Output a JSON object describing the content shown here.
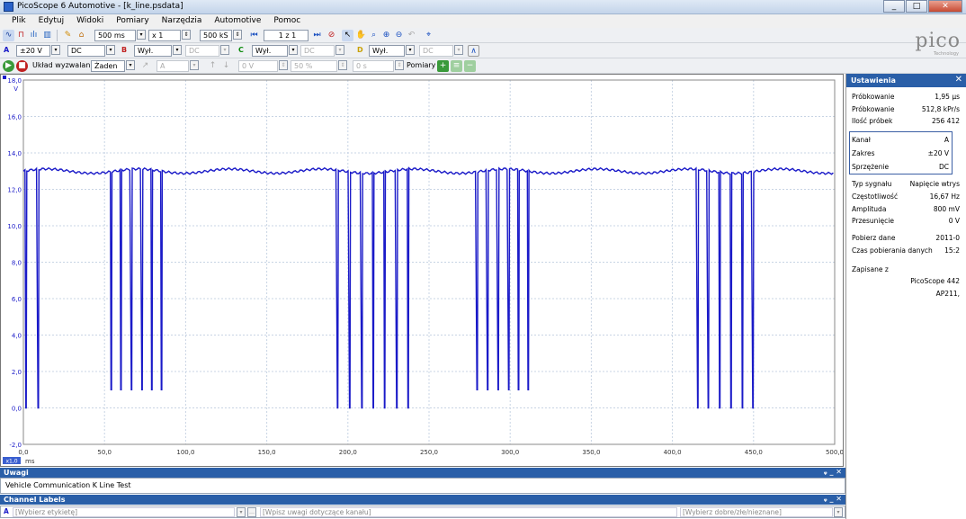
{
  "window": {
    "title": "PicoScope 6 Automotive - [k_line.psdata]",
    "min": "_",
    "max": "□",
    "close": "✕"
  },
  "menu": [
    "Plik",
    "Edytuj",
    "Widoki",
    "Pomiary",
    "Narzędzia",
    "Automotive",
    "Pomoc"
  ],
  "toolbar1": {
    "timebase": "500 ms",
    "zoom": "x 1",
    "samples": "500 kS",
    "buffer": "1 z 1"
  },
  "toolbar2": {
    "ch_a_label": "A",
    "ch_a_range": "±20 V",
    "ch_a_coupling": "DC",
    "ch_b_label": "B",
    "ch_b_range": "Wył.",
    "ch_b_coupling": "DC",
    "ch_c_label": "C",
    "ch_c_range": "Wył.",
    "ch_c_coupling": "DC",
    "ch_d_label": "D",
    "ch_d_range": "Wył.",
    "ch_d_coupling": "DC"
  },
  "toolbar3": {
    "trigger_label": "Układ wyzwalania",
    "trigger_mode": "Żaden",
    "trigger_channel": "A",
    "trigger_level": "0 V",
    "trigger_pre": "50 %",
    "trigger_delay": "0 s",
    "measurements_label": "Pomiary"
  },
  "logo": {
    "text": "pico",
    "sub": "Technology"
  },
  "settings_panel": {
    "title": "Ustawienia",
    "rows": [
      {
        "k": "Próbkowanie",
        "v": "1,95 µs"
      },
      {
        "k": "Próbkowanie",
        "v": "512,8 kPr/s"
      },
      {
        "k": "Ilość próbek",
        "v": "256 412"
      }
    ],
    "channel": [
      {
        "k": "Kanał",
        "v": "A"
      },
      {
        "k": "Zakres",
        "v": "±20 V"
      },
      {
        "k": "Sprzężenie",
        "v": "DC"
      }
    ],
    "signal": [
      {
        "k": "Typ sygnału",
        "v": "Napięcie wtrys"
      },
      {
        "k": "Częstotliwość",
        "v": "16,67 Hz"
      },
      {
        "k": "Amplituda",
        "v": "800 mV"
      },
      {
        "k": "Przesunięcie",
        "v": "0 V"
      }
    ],
    "capture": [
      {
        "k": "Pobierz dane",
        "v": "2011-0"
      },
      {
        "k": "Czas pobierania danych",
        "v": "15:2"
      }
    ],
    "saved_label": "Zapisane z",
    "saved_device": "PicoScope 442",
    "saved_serial": "AP211,"
  },
  "notes": {
    "title": "Uwagi",
    "text": "Vehicle Communication K Line Test",
    "controls": "ᵩ _ ✕"
  },
  "channel_labels": {
    "title": "Channel Labels",
    "controls": "ᵩ _ ✕",
    "channel": "A",
    "label_placeholder": "[Wybierz etykietę]",
    "note_placeholder": "[Wpisz uwagi dotyczące kanału]",
    "status_placeholder": "[Wybierz dobre/złe/nieznane]"
  },
  "chart_data": {
    "type": "line",
    "ylabel": "V",
    "xlabel": "ms",
    "xlim": [
      0,
      500
    ],
    "ylim": [
      -2,
      18
    ],
    "x_ticks": [
      "0,0",
      "50,0",
      "100,0",
      "150,0",
      "200,0",
      "250,0",
      "300,0",
      "350,0",
      "400,0",
      "450,0",
      "500,0"
    ],
    "y_ticks": [
      "-2,0",
      "0,0",
      "2,0",
      "4,0",
      "6,0",
      "8,0",
      "10,0",
      "12,0",
      "14,0",
      "16,0",
      "18,0"
    ],
    "scale_badge": "x1,0",
    "series_color": "#1a1ac8",
    "baseline_v": 13.0,
    "dips": [
      {
        "t": 1.5,
        "low": 0.0
      },
      {
        "t": 9.0,
        "low": 0.0
      },
      {
        "t": 54.0,
        "low": 1.0
      },
      {
        "t": 60.0,
        "low": 1.0
      },
      {
        "t": 66.5,
        "low": 1.0
      },
      {
        "t": 73.0,
        "low": 1.0
      },
      {
        "t": 79.0,
        "low": 1.0
      },
      {
        "t": 85.0,
        "low": 1.0
      },
      {
        "t": 193.5,
        "low": 0.0
      },
      {
        "t": 201.0,
        "low": 0.0
      },
      {
        "t": 208.5,
        "low": 0.0
      },
      {
        "t": 215.5,
        "low": 0.0
      },
      {
        "t": 222.5,
        "low": 0.0
      },
      {
        "t": 230.0,
        "low": 0.0
      },
      {
        "t": 237.0,
        "low": 0.0
      },
      {
        "t": 279.5,
        "low": 1.0
      },
      {
        "t": 286.0,
        "low": 1.0
      },
      {
        "t": 292.5,
        "low": 1.0
      },
      {
        "t": 299.0,
        "low": 1.0
      },
      {
        "t": 305.0,
        "low": 1.0
      },
      {
        "t": 311.0,
        "low": 1.0
      },
      {
        "t": 415.5,
        "low": 0.0
      },
      {
        "t": 422.0,
        "low": 0.0
      },
      {
        "t": 429.0,
        "low": 0.0
      },
      {
        "t": 436.0,
        "low": 0.0
      },
      {
        "t": 443.0,
        "low": 0.0
      },
      {
        "t": 449.5,
        "low": 0.0
      }
    ]
  }
}
